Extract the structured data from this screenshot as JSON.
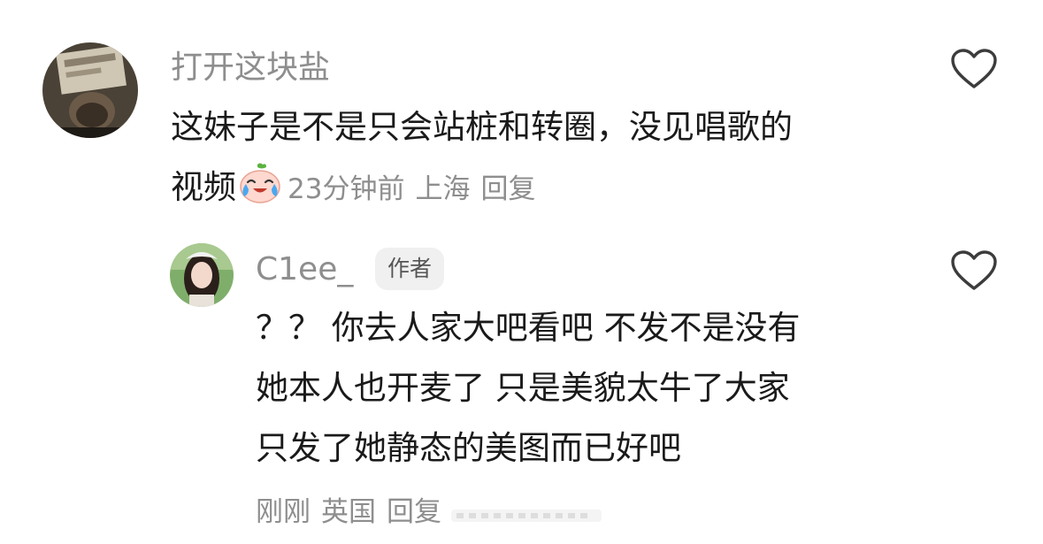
{
  "comments": [
    {
      "username": "打开这块盐",
      "text_lines": [
        "这妹子是不是只会站桩和转圈，没见唱歌的",
        "视频"
      ],
      "emoji_icon": "laughing-crying-emoji-icon",
      "time": "23分钟前",
      "location": "上海",
      "reply_label": "回复"
    },
    {
      "username": "C1ee_",
      "author_badge": "作者",
      "text_lines": [
        "？？ 你去人家大吧看吧 不发不是没有",
        "她本人也开麦了 只是美貌太牛了大家",
        "只发了她静态的美图而已好吧"
      ],
      "time": "刚刚",
      "location": "英国",
      "reply_label": "回复"
    }
  ],
  "icons": {
    "like": "heart-outline-icon"
  },
  "colors": {
    "username": "#8e8e8e",
    "meta": "#8e8e8e",
    "text": "#1a1a1a",
    "badge_bg": "#f0f0f0"
  }
}
